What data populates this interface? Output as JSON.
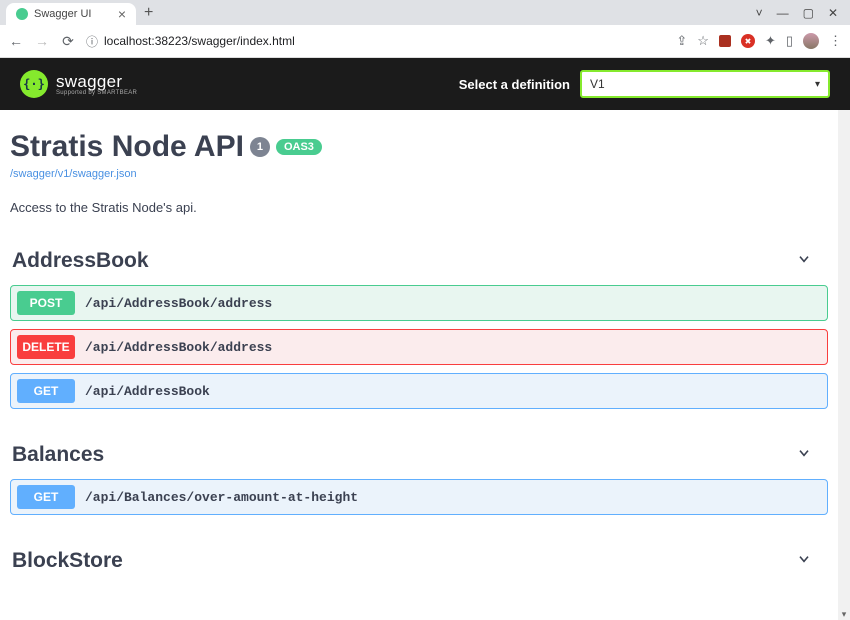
{
  "browser": {
    "tab_title": "Swagger UI",
    "url": "localhost:38223/swagger/index.html"
  },
  "topbar": {
    "logo_main": "swagger",
    "logo_sub": "Supported by SMARTBEAR",
    "select_label": "Select a definition",
    "selected_definition": "V1"
  },
  "info": {
    "title": "Stratis Node API",
    "version": "1",
    "oas": "OAS3",
    "spec_link": "/swagger/v1/swagger.json",
    "description": "Access to the Stratis Node's api."
  },
  "tags": [
    {
      "name": "AddressBook",
      "ops": [
        {
          "method": "POST",
          "method_class": "post",
          "path": "/api/AddressBook/address"
        },
        {
          "method": "DELETE",
          "method_class": "delete",
          "path": "/api/AddressBook/address"
        },
        {
          "method": "GET",
          "method_class": "get",
          "path": "/api/AddressBook"
        }
      ]
    },
    {
      "name": "Balances",
      "ops": [
        {
          "method": "GET",
          "method_class": "get",
          "path": "/api/Balances/over-amount-at-height"
        }
      ]
    },
    {
      "name": "BlockStore",
      "ops": []
    }
  ]
}
